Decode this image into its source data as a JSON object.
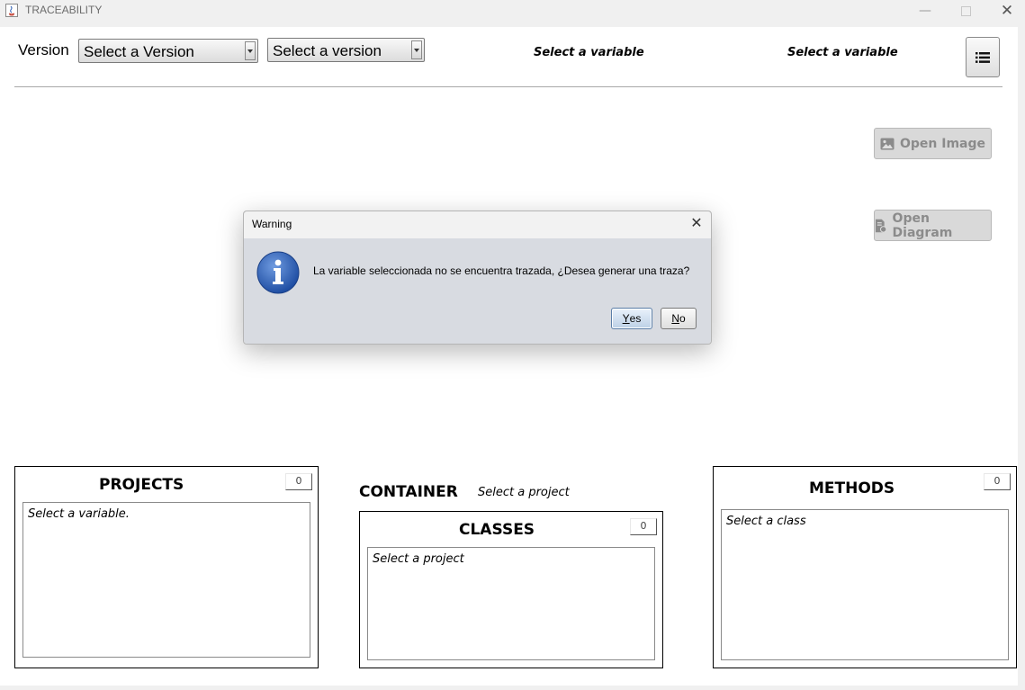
{
  "window": {
    "title": "TRACEABILITY",
    "controls": [
      "minimize",
      "maximize",
      "close"
    ]
  },
  "toolbar": {
    "version_label": "Version",
    "version_combo_1": "Select a Version",
    "version_combo_2": "Select a version",
    "variable_label_1": "Select a variable",
    "variable_label_2": "Select a variable",
    "menu_icon": "list-icon"
  },
  "side_buttons": {
    "open_image": "Open Image",
    "open_diagram": "Open Diagram"
  },
  "projects_panel": {
    "title": "PROJECTS",
    "count": "0",
    "placeholder": "Select a variable."
  },
  "container": {
    "label": "CONTAINER",
    "hint": "Select a project"
  },
  "classes_panel": {
    "title": "CLASSES",
    "count": "0",
    "placeholder": "Select a project"
  },
  "methods_panel": {
    "title": "METHODS",
    "count": "0",
    "placeholder": "Select a class"
  },
  "dialog": {
    "title": "Warning",
    "icon": "info-icon",
    "message": "La variable seleccionada no se encuentra trazada, ¿Desea generar una traza?",
    "yes_mnemonic": "Y",
    "yes_rest": "es",
    "no_mnemonic": "N",
    "no_rest": "o"
  },
  "colors": {
    "info_icon": "#2f5fb3",
    "yes_button_border": "#5a7ea8"
  }
}
